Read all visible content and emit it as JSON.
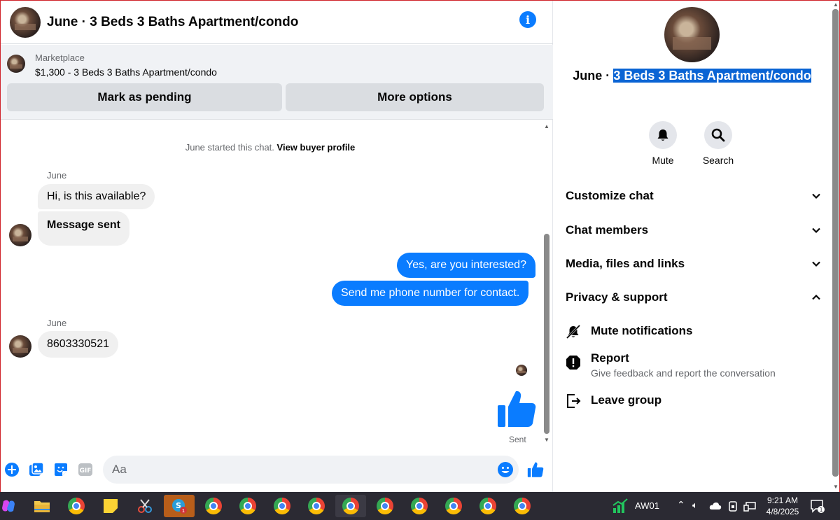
{
  "chat": {
    "title": "June · 3 Beds 3 Baths Apartment/condo",
    "marketplace": {
      "label": "Marketplace",
      "listing": "$1,300 - 3 Beds 3 Baths Apartment/condo",
      "pending_button": "Mark as pending",
      "more_button": "More options"
    },
    "started_text": "June started this chat.",
    "view_profile": "View buyer profile",
    "messages": [
      {
        "sender": "June",
        "text": "Hi, is this available?",
        "direction": "in"
      },
      {
        "text": "Message sent",
        "direction": "in"
      },
      {
        "text": "Yes, are you interested?",
        "direction": "out"
      },
      {
        "text": "Send me phone number for contact.",
        "direction": "out"
      },
      {
        "sender": "June",
        "text": "8603330521",
        "direction": "in"
      }
    ],
    "sent_label": "Sent",
    "composer_placeholder": "Aa"
  },
  "info": {
    "name_prefix": "June · ",
    "name_selected": "3 Beds 3 Baths Apartment/condo",
    "actions": [
      {
        "label": "Mute",
        "icon": "bell-icon"
      },
      {
        "label": "Search",
        "icon": "search-icon"
      }
    ],
    "sections": [
      {
        "label": "Customize chat",
        "expanded": false
      },
      {
        "label": "Chat members",
        "expanded": false
      },
      {
        "label": "Media, files and links",
        "expanded": false
      },
      {
        "label": "Privacy & support",
        "expanded": true
      }
    ],
    "privacy_items": [
      {
        "label": "Mute notifications",
        "icon": "bell-off-icon",
        "desc": ""
      },
      {
        "label": "Report",
        "icon": "report-icon",
        "desc": "Give feedback and report the conversation"
      },
      {
        "label": "Leave group",
        "icon": "leave-icon",
        "desc": ""
      }
    ]
  },
  "taskbar": {
    "tray_label": "AW01",
    "time": "9:21 AM",
    "date": "4/8/2025",
    "notification_count": "1",
    "app_badge": "1"
  },
  "colors": {
    "accent": "#0a7cff",
    "selection": "#0a64d4",
    "taskbar": "#2b2a33"
  }
}
